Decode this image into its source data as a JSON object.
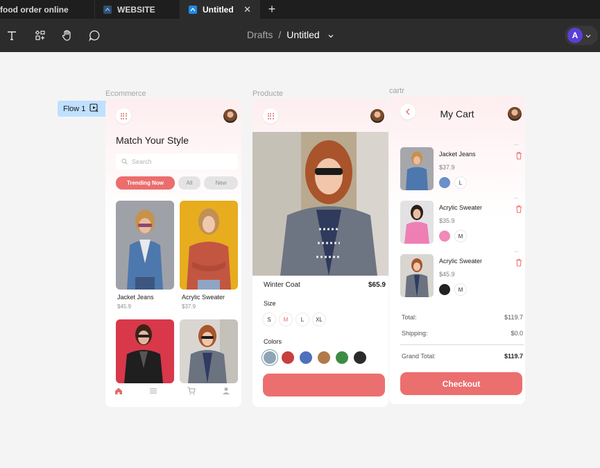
{
  "tabs": [
    {
      "label": "food order online",
      "active": false
    },
    {
      "label": "WEBSITE",
      "active": false
    },
    {
      "label": "Untitled",
      "active": true
    }
  ],
  "toolbar": {
    "breadcrumb_root": "Drafts",
    "breadcrumb_sep": "/",
    "file_name": "Untitled",
    "avatar_initial": "A",
    "tools": [
      "text-icon",
      "components-icon",
      "hand-icon",
      "comment-icon"
    ]
  },
  "canvas": {
    "flow_label": "Flow 1",
    "frames": {
      "ecommerce": {
        "label": "Ecommerce",
        "title": "Match Your Style",
        "search_placeholder": "Search",
        "chips": [
          "Trending Now",
          "All",
          "New"
        ],
        "products": [
          {
            "name": "Jacket Jeans",
            "price": "$45.9"
          },
          {
            "name": "Acrylic Sweater",
            "price": "$37.9"
          }
        ],
        "nav": [
          "home-icon",
          "list-icon",
          "cart-icon",
          "user-icon"
        ]
      },
      "product": {
        "label": "Producte",
        "name": "Winter Coat",
        "price": "$65.9",
        "size_label": "Size",
        "sizes": [
          "S",
          "M",
          "L",
          "XL"
        ],
        "selected_size": "M",
        "colors_label": "Colors",
        "colors": [
          "#8fa4b5",
          "#c73f3f",
          "#4f6fbf",
          "#b27a4a",
          "#3d8c45",
          "#2b2b2b"
        ]
      },
      "cart": {
        "label": "cartr",
        "title": "My Cart",
        "items": [
          {
            "name": "Jacket Jeans",
            "price": "$37.9",
            "color": "#6a8fc9",
            "size": "L"
          },
          {
            "name": "Acrylic Sweater",
            "price": "$35.9",
            "color": "#f08ab8",
            "size": "M"
          },
          {
            "name": "Acrylic Sweater",
            "price": "$45.9",
            "color": "#222222",
            "size": "M"
          }
        ],
        "more_label": "...",
        "total_label": "Total:",
        "total_value": "$119.7",
        "shipping_label": "Shipping:",
        "shipping_value": "$0.0",
        "grand_label": "Grand Total:",
        "grand_value": "$119.7",
        "checkout_label": "Checkout"
      }
    }
  },
  "colors": {
    "accent": "#ec6f6f",
    "flow_badge": "#bfe0ff",
    "toolbar_bg": "#2c2c2c",
    "avatar": "#5b3fd6"
  }
}
